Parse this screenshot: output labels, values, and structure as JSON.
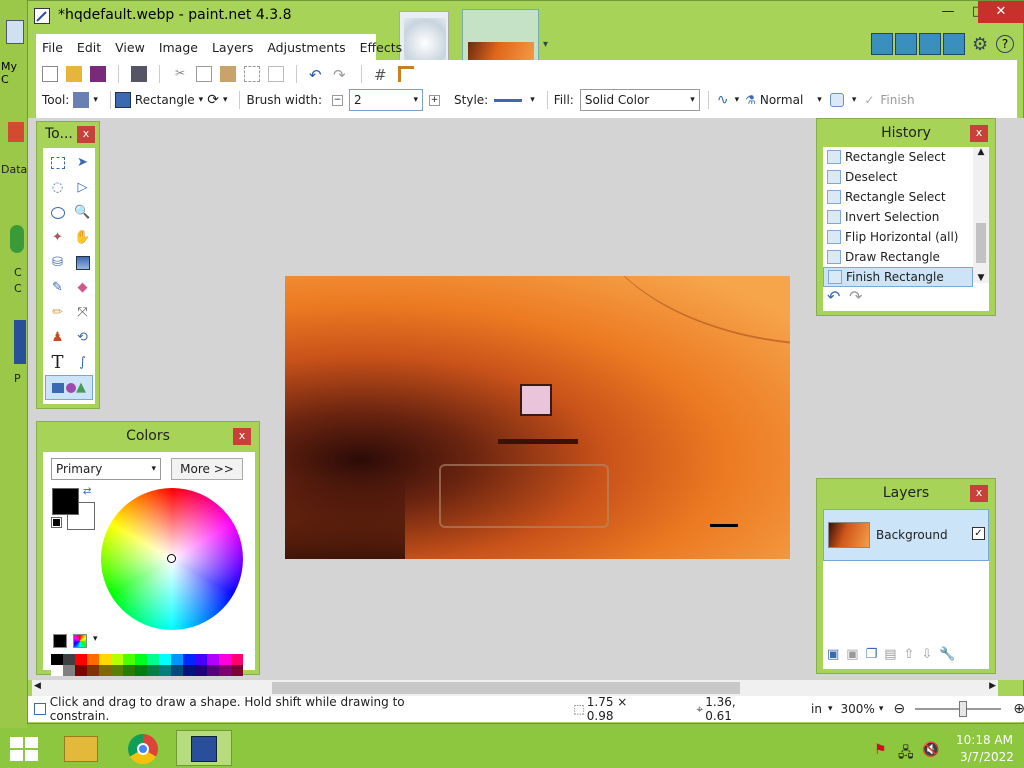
{
  "window": {
    "title": "*hqdefault.webp - paint.net 4.3.8",
    "minimize": "—",
    "maximize": "□",
    "close": "✕"
  },
  "menu": [
    "File",
    "Edit",
    "View",
    "Image",
    "Layers",
    "Adjustments",
    "Effects"
  ],
  "toolbar2": {
    "tool_label": "Tool:",
    "shape_label": "Rectangle",
    "brush_width_label": "Brush width:",
    "brush_width_value": "2",
    "style_label": "Style:",
    "fill_label": "Fill:",
    "fill_value": "Solid Color",
    "blend_label": "Normal",
    "finish_label": "Finish"
  },
  "tools_panel": {
    "title": "To...",
    "close": "x"
  },
  "history_panel": {
    "title": "History",
    "close": "x",
    "items": [
      "Rectangle Select",
      "Deselect",
      "Rectangle Select",
      "Invert Selection",
      "Flip Horizontal (all)",
      "Draw Rectangle",
      "Finish Rectangle"
    ],
    "selected_index": 6
  },
  "colors_panel": {
    "title": "Colors",
    "close": "x",
    "mode": "Primary",
    "more_button": "More >>",
    "primary_color": "#000000",
    "secondary_color": "#ffffff"
  },
  "layers_panel": {
    "title": "Layers",
    "close": "x",
    "layers": [
      {
        "name": "Background",
        "visible": true
      }
    ]
  },
  "status": {
    "hint": "Click and drag to draw a shape. Hold shift while drawing to constrain.",
    "selection_size": "1.75 × 0.98",
    "cursor_pos": "1.36, 0.61",
    "units": "in",
    "zoom": "300%"
  },
  "desktop": {
    "partial_labels": [
      "My C",
      "Data",
      "C",
      "C",
      "P"
    ]
  },
  "taskbar": {
    "time": "10:18 AM",
    "date": "3/7/2022"
  },
  "colors": {
    "frame": "#a7d458",
    "panel_close": "#c8403a",
    "selection": "#cce4f7",
    "taskbar": "#8dc63f"
  }
}
